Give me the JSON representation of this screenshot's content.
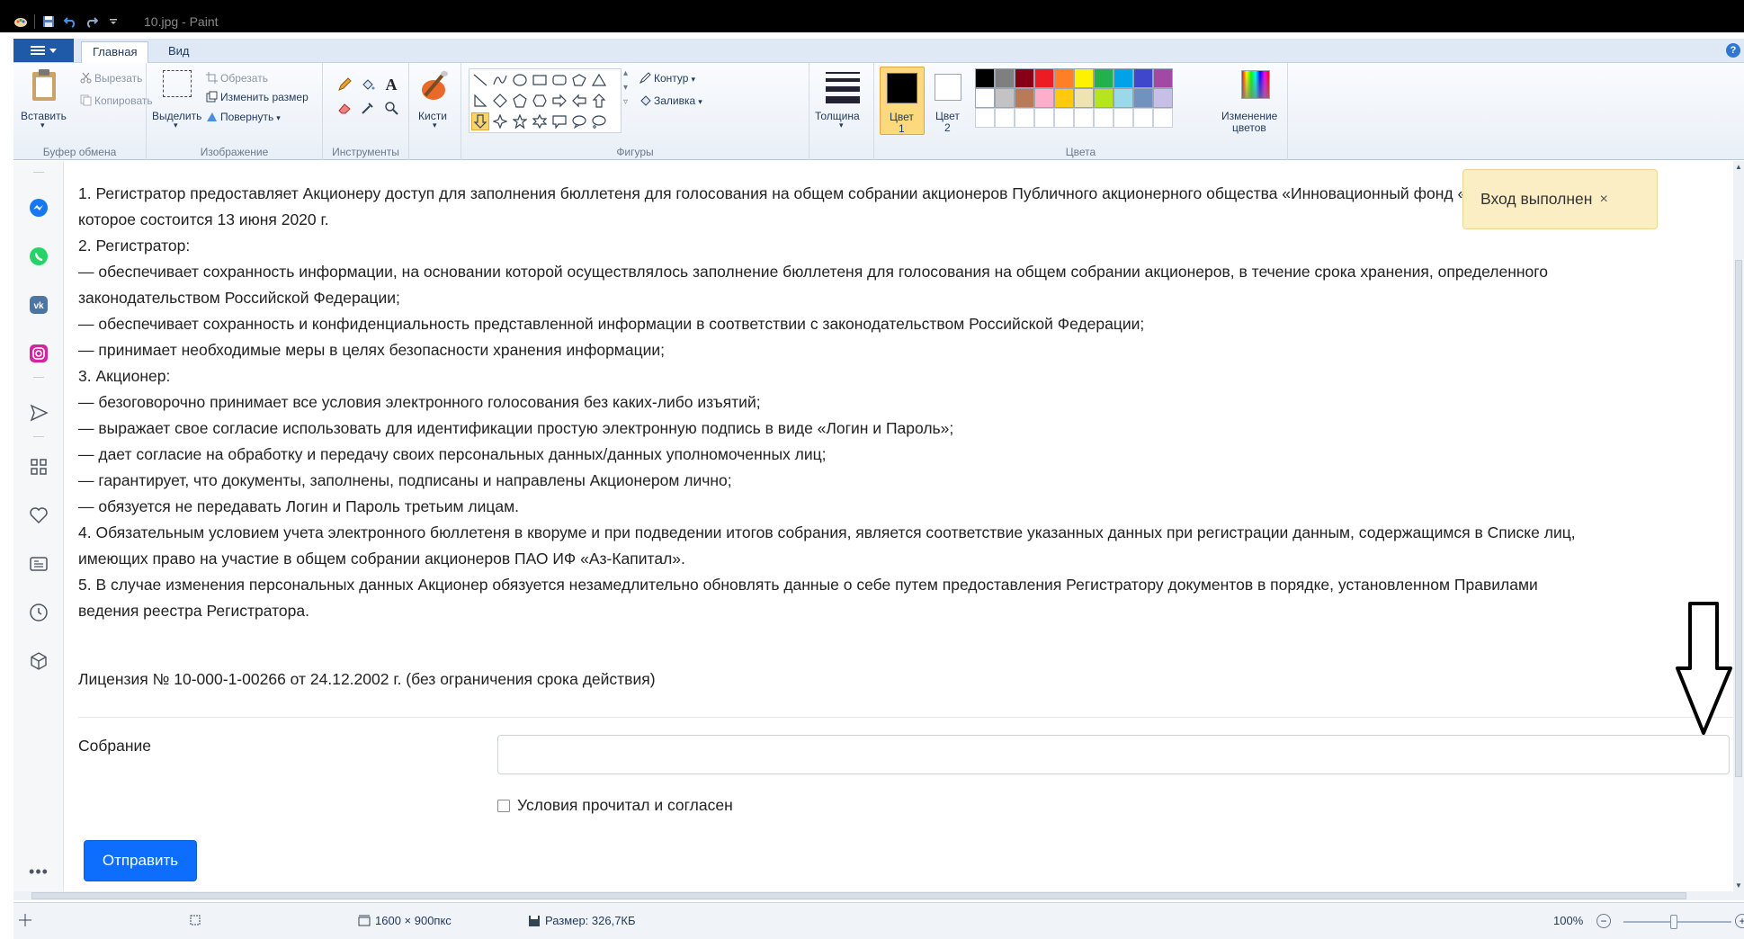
{
  "window": {
    "title": "10.jpg - Paint"
  },
  "ribbon_tabs": {
    "home": "Главная",
    "view": "Вид"
  },
  "ribbon": {
    "clipboard": {
      "paste": "Вставить",
      "cut": "Вырезать",
      "copy": "Копировать",
      "label": "Буфер обмена"
    },
    "image": {
      "select": "Выделить",
      "crop": "Обрезать",
      "resize": "Изменить размер",
      "rotate": "Повернуть",
      "label": "Изображение"
    },
    "tools": {
      "label": "Инструменты"
    },
    "brushes": "Кисти",
    "shapes": {
      "outline": "Контур",
      "fill": "Заливка",
      "label": "Фигуры"
    },
    "size": "Толщина",
    "colors": {
      "color1": "Цвет",
      "color1_num": "1",
      "color2": "Цвет",
      "color2_num": "2",
      "edit_line1": "Изменение",
      "edit_line2": "цветов",
      "label": "Цвета",
      "palette_row1": [
        "#000000",
        "#7f7f7f",
        "#880015",
        "#ed1c24",
        "#ff7f27",
        "#fff200",
        "#22b14c",
        "#00a2e8",
        "#3f48cc",
        "#a349a4"
      ],
      "palette_row2": [
        "#ffffff",
        "#c3c3c3",
        "#b97a57",
        "#ffaec9",
        "#ffc90e",
        "#efe4b0",
        "#b5e61d",
        "#99d9ea",
        "#7092be",
        "#c8bfe7"
      ]
    }
  },
  "toast": {
    "text": "Вход выполнен",
    "close": "×"
  },
  "content": {
    "lines": [
      "1. Регистратор предоставляет Акционеру доступ для заполнения бюллетеня для голосования на общем собрании акционеров Публичного акционерного общества «Инновационный фонд «Аз-Капитал»,",
      "которое состоится 13 июня 2020 г.",
      "2. Регистратор:",
      "— обеспечивает сохранность информации, на основании которой осуществлялось заполнение бюллетеня для голосования на общем собрании акционеров, в течение срока хранения, определенного",
      "законодательством Российской Федерации;",
      "— обеспечивает сохранность и конфиденциальность представленной информации в соответствии с законодательством Российской Федерации;",
      "— принимает необходимые меры в целях безопасности хранения информации;",
      "3. Акционер:",
      "— безоговорочно принимает все условия электронного голосования без каких-либо изъятий;",
      "— выражает свое согласие использовать для идентификации простую электронную подпись в виде «Логин и Пароль»;",
      "— дает согласие на обработку и передачу своих персональных данных/данных уполномоченных лиц;",
      "— гарантирует, что документы, заполнены, подписаны и направлены Акционером лично;",
      "— обязуется не передавать Логин и Пароль третьим лицам.",
      "4. Обязательным условием учета электронного бюллетеня в кворуме и при подведении итогов собрания, является соответствие указанных данных при регистрации данным, содержащимся в Списке лиц,",
      "имеющих право на участие в общем собрании акционеров ПАО ИФ «Аз-Капитал».",
      "5. В случае изменения персональных данных Акционер обязуется незамедлительно обновлять данные о себе путем предоставления Регистратору документов в порядке, установленном Правилами",
      "ведения реестра Регистратора."
    ],
    "license": "Лицензия № 10-000-1-00266 от 24.12.2002 г. (без ограничения срока действия)"
  },
  "form": {
    "meeting_label": "Собрание",
    "meeting_value": "",
    "agree_label": "Условия прочитал и согласен",
    "submit": "Отправить"
  },
  "statusbar": {
    "dimensions": "1600 × 900пкс",
    "size": "Размер: 326,7КБ",
    "zoom": "100%"
  }
}
